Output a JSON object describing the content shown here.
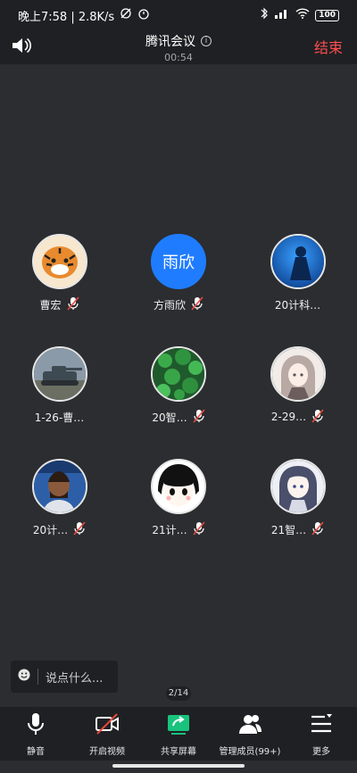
{
  "status": {
    "time": "晚上7:58 | 2.8K/s",
    "battery": "100"
  },
  "header": {
    "title": "腾讯会议",
    "timer": "00:54",
    "end_label": "结束"
  },
  "participants": [
    {
      "name": "曹宏",
      "avatar": "tiger-avatar",
      "mic": "muted"
    },
    {
      "name": "方雨欣",
      "avatar_text": "雨欣",
      "mic": "muted"
    },
    {
      "name": "20计科…",
      "avatar": "blue-figure-avatar",
      "mic": "none"
    },
    {
      "name": "1-26-曹…",
      "avatar": "tank-avatar",
      "mic": "none"
    },
    {
      "name": "20智…",
      "avatar": "leaves-avatar",
      "mic": "muted"
    },
    {
      "name": "2-29…",
      "avatar": "anime-girl-avatar",
      "mic": "muted"
    },
    {
      "name": "20计…",
      "avatar": "player-avatar",
      "mic": "muted"
    },
    {
      "name": "21计…",
      "avatar": "cartoon-face-avatar",
      "mic": "muted"
    },
    {
      "name": "21智…",
      "avatar": "anime-girl2-avatar",
      "mic": "muted"
    }
  ],
  "chat": {
    "placeholder": "说点什么..."
  },
  "pager": "2/14",
  "toolbar": {
    "mute": "静音",
    "video": "开启视频",
    "share": "共享屏幕",
    "members": "管理成员(99+)",
    "more": "更多"
  },
  "colors": {
    "accent_blue": "#1f7cff",
    "end_red": "#ff4d4f",
    "share_green": "#19c37d",
    "mute_red": "#e8483f"
  }
}
